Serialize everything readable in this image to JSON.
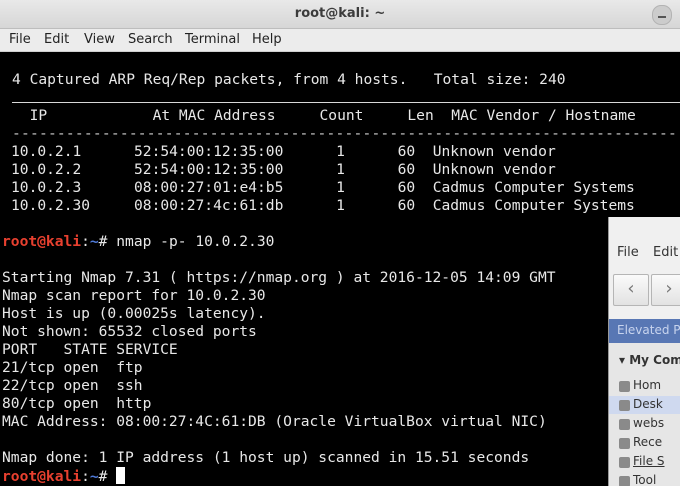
{
  "window": {
    "title": "root@kali: ~"
  },
  "menu": {
    "items": [
      "File",
      "Edit",
      "View",
      "Search",
      "Terminal",
      "Help"
    ]
  },
  "terminal": {
    "arp_summary": "4 Captured ARP Req/Rep packets, from 4 hosts.   Total size: 240",
    "table_header": "  IP            At MAC Address     Count     Len  MAC Vendor / Hostname",
    "table_rows": [
      "10.0.2.1      52:54:00:12:35:00      1      60  Unknown vendor",
      "10.0.2.2      52:54:00:12:35:00      1      60  Unknown vendor",
      "10.0.2.3      08:00:27:01:e4:b5      1      60  Cadmus Computer Systems",
      "10.0.2.30     08:00:27:4c:61:db      1      60  Cadmus Computer Systems"
    ],
    "prompt_user": "root@kali",
    "prompt_sep": ":",
    "prompt_path": "~",
    "prompt_char": "# ",
    "command": "nmap -p- 10.0.2.30",
    "output": [
      "Starting Nmap 7.31 ( https://nmap.org ) at 2016-12-05 14:09 GMT",
      "Nmap scan report for 10.0.2.30",
      "Host is up (0.00025s latency).",
      "Not shown: 65532 closed ports",
      "PORT   STATE SERVICE",
      "21/tcp open  ftp",
      "22/tcp open  ssh",
      "80/tcp open  http",
      "MAC Address: 08:00:27:4C:61:DB (Oracle VirtualBox virtual NIC)",
      "",
      "Nmap done: 1 IP address (1 host up) scanned in 15.51 seconds"
    ]
  },
  "background_window": {
    "menu": [
      "File",
      "Edit"
    ],
    "banner": "Elevated P",
    "sidebar_title": "My Com",
    "sidebar_items": [
      "Hom",
      "Desk",
      "webs",
      "Rece",
      "File S",
      "Tool"
    ]
  }
}
